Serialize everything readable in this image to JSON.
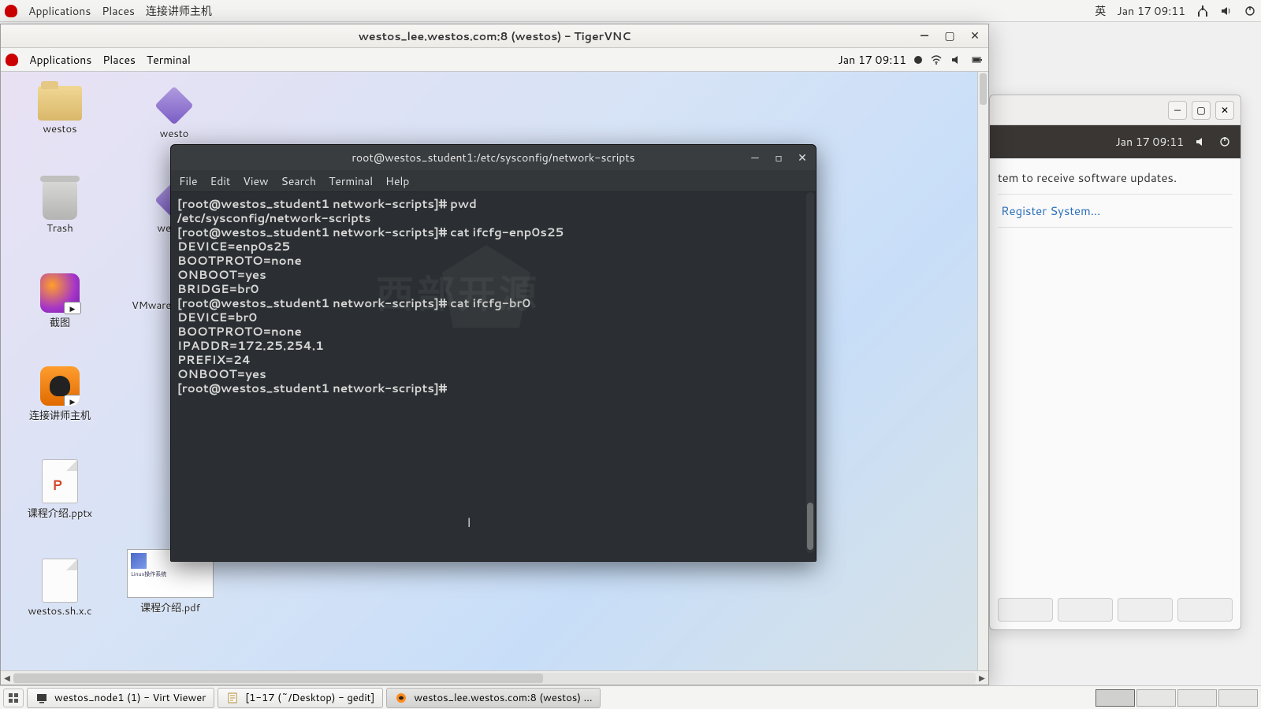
{
  "host_panel": {
    "applications": "Applications",
    "places": "Places",
    "cn_item": "连接讲师主机",
    "ime": "英",
    "date": "Jan 17  09:11"
  },
  "reg_window": {
    "inner_date": "Jan 17  09:11",
    "body_text": "tem to receive software updates.",
    "link": "Register System..."
  },
  "vnc": {
    "title": "westos_lee.westos.com:8 (westos) - TigerVNC"
  },
  "guest_panel": {
    "applications": "Applications",
    "places": "Places",
    "terminal": "Terminal",
    "date": "Jan 17  09:11"
  },
  "icons": {
    "westos": "westos",
    "westos2": "westo",
    "trash": "Trash",
    "westos3": "westos",
    "jietu": "截图",
    "vmware": "VMware-",
    "connect": "连接讲师主机",
    "pptx": "课程介绍.pptx",
    "script": "westos.sh.x.c",
    "pdf": "课程介绍.pdf"
  },
  "terminal": {
    "title": "root@westos_student1:/etc/sysconfig/network-scripts",
    "menu": {
      "file": "File",
      "edit": "Edit",
      "view": "View",
      "search": "Search",
      "terminal": "Terminal",
      "help": "Help"
    },
    "lines": [
      {
        "type": "promptcmd",
        "prompt": "[root@westos_student1 network-scripts]#",
        "cmd": " pwd"
      },
      {
        "type": "out",
        "text": "/etc/sysconfig/network-scripts"
      },
      {
        "type": "promptcmd",
        "prompt": "[root@westos_student1 network-scripts]#",
        "cmd": " cat ifcfg-enp0s25"
      },
      {
        "type": "out",
        "text": "DEVICE=enp0s25"
      },
      {
        "type": "out",
        "text": "BOOTPROTO=none"
      },
      {
        "type": "out",
        "text": "ONBOOT=yes"
      },
      {
        "type": "out",
        "text": "BRIDGE=br0"
      },
      {
        "type": "promptcmd",
        "prompt": "[root@westos_student1 network-scripts]#",
        "cmd": " cat ifcfg-br0"
      },
      {
        "type": "out",
        "text": "DEVICE=br0"
      },
      {
        "type": "out",
        "text": "BOOTPROTO=none"
      },
      {
        "type": "out",
        "text": "IPADDR=172.25.254.1"
      },
      {
        "type": "out",
        "text": "PREFIX=24"
      },
      {
        "type": "out",
        "text": "ONBOOT=yes"
      },
      {
        "type": "promptcmd",
        "prompt": "[root@westos_student1 network-scripts]#",
        "cmd": " "
      }
    ],
    "watermark": "西部开源"
  },
  "taskbar": {
    "item1": "westos_node1 (1) - Virt Viewer",
    "item2": "[1-17 (~/Desktop) - gedit]",
    "item3": "westos_lee.westos.com:8 (westos) ..."
  }
}
